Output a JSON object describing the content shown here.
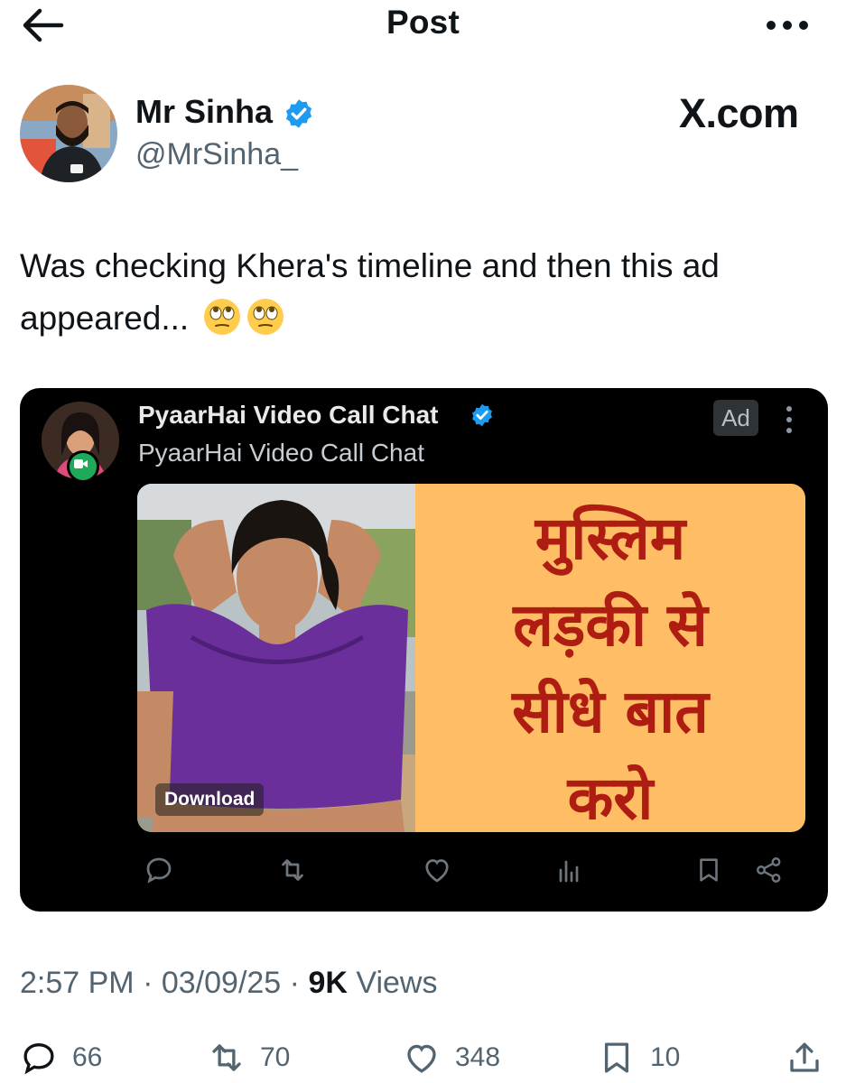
{
  "header": {
    "title": "Post"
  },
  "author": {
    "name": "Mr Sinha",
    "handle": "@MrSinha_"
  },
  "watermark": "X.com",
  "tweet": {
    "text": "Was checking Khera's timeline and then this ad appeared...",
    "emoji": "face-with-rolling-eyes"
  },
  "embedded_ad": {
    "name": "PyaarHai Video Call Chat",
    "handle": "PyaarHai Video Call Chat",
    "badge": "Ad",
    "banner_lines": [
      "मुस्लिम",
      "लड़की से",
      "सीधे बात",
      "करो"
    ],
    "download_label": "Download",
    "banner_color": "#ffbd66",
    "banner_text_color": "#ae1c12"
  },
  "meta": {
    "time": "2:57 PM",
    "date": "03/09/25",
    "views_count": "9K",
    "views_label": "Views"
  },
  "actions": {
    "replies": "66",
    "reposts": "70",
    "likes": "348",
    "bookmarks": "10"
  },
  "colors": {
    "accent": "#1d9bf0",
    "text": "#0f1419",
    "secondary": "#536471"
  }
}
